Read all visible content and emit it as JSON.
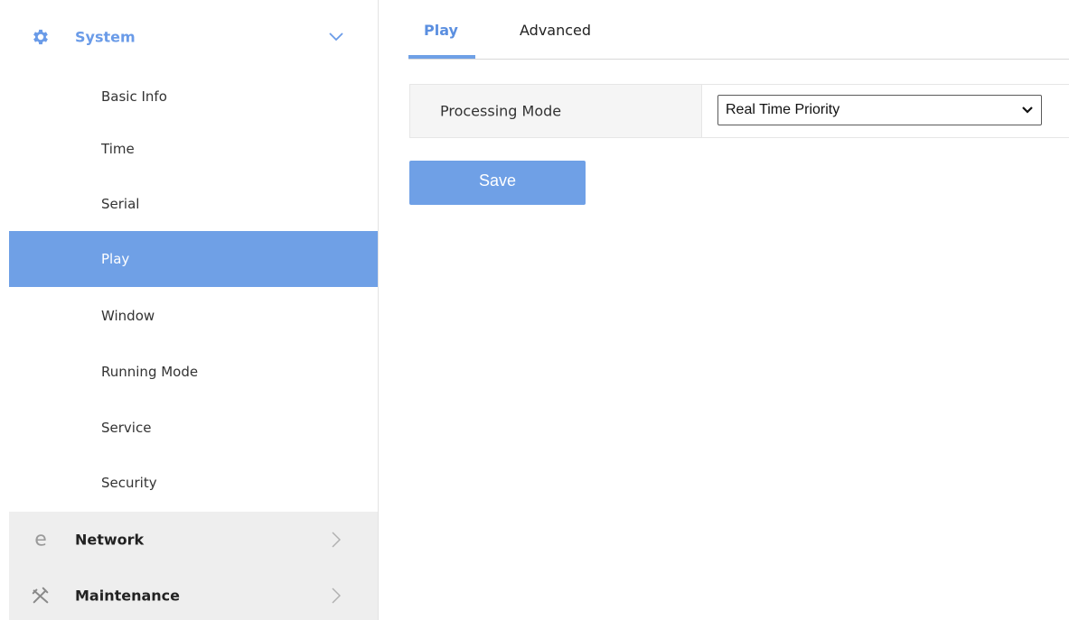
{
  "colors": {
    "accent": "#6fa0e6",
    "accent_text": "#5b8fe0",
    "sidebar_gray": "#eeeeee"
  },
  "sidebar": {
    "groups": [
      {
        "label": "System",
        "icon": "gear-icon",
        "expanded": true
      },
      {
        "label": "Network",
        "icon": "ie-e-icon",
        "expanded": false
      },
      {
        "label": "Maintenance",
        "icon": "tools-icon",
        "expanded": false
      }
    ],
    "items": [
      {
        "label": "Basic Info",
        "active": false
      },
      {
        "label": "Time",
        "active": false
      },
      {
        "label": "Serial",
        "active": false
      },
      {
        "label": "Play",
        "active": true
      },
      {
        "label": "Window",
        "active": false
      },
      {
        "label": "Running Mode",
        "active": false
      },
      {
        "label": "Service",
        "active": false
      },
      {
        "label": "Security",
        "active": false
      }
    ]
  },
  "tabs": [
    {
      "label": "Play",
      "active": true
    },
    {
      "label": "Advanced",
      "active": false
    }
  ],
  "form": {
    "processing_mode_label": "Processing Mode",
    "processing_mode_value": "Real Time Priority"
  },
  "actions": {
    "save_label": "Save"
  }
}
